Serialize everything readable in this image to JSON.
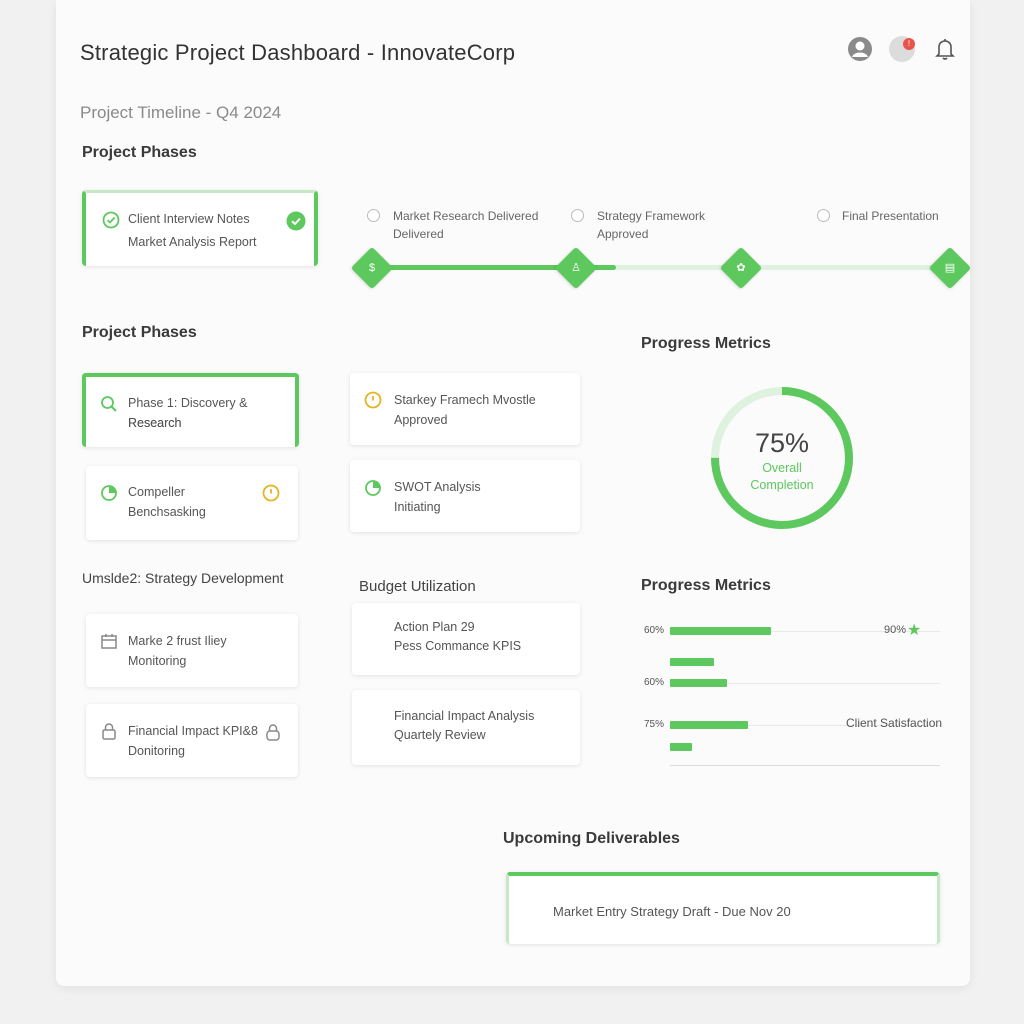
{
  "header": {
    "title": "Strategic Project Dashboard - InnovateCorp",
    "subtitle": "Project Timeline - Q4 2024",
    "icons": [
      "user-avatar-icon",
      "notification-badge-icon",
      "bell-icon"
    ],
    "badge_count": "!"
  },
  "sections": {
    "phases_top": "Project Phases",
    "phases_mid": "Project Phases",
    "progress_metrics_top": "Progress Metrics",
    "phase2_heading": "Umslde2: Strategy Development",
    "budget": "Budget Utilization",
    "progress_metrics_bottom": "Progress Metrics",
    "upcoming": "Upcoming Deliverables"
  },
  "top_card": {
    "line1": "Client Interview Notes",
    "line2": "Market Analysis Report"
  },
  "timeline": {
    "milestones": [
      {
        "line1": "Market Research Delivered",
        "line2": "Delivered"
      },
      {
        "line1": "Strategy Framework",
        "line2": "Approved"
      },
      {
        "line1": "Final Presentation",
        "line2": ""
      }
    ]
  },
  "phase_cards": {
    "discovery": {
      "line1": "Phase 1: Discovery & Research",
      "line2": "Research"
    },
    "competitor": {
      "line1": "Compeller",
      "line2": "Benchsasking"
    },
    "starkey": {
      "line1": "Starkey Framech Mvostle",
      "line2": "Approved"
    },
    "swot": {
      "line1": "SWOT Analysis",
      "line2": "Initiating"
    },
    "market": {
      "line1": "Marke 2 frust Iliey",
      "line2": "Monitoring"
    },
    "financial_kpi": {
      "line1": "Financial Impact KPI&8",
      "line2": "Donitoring"
    },
    "action_plan": {
      "line1": "Action Plan 29",
      "line2": "Pess Commance KPIS"
    },
    "financial_analysis": {
      "line1": "Financial Impact Analysis",
      "line2": "Quartely Review"
    }
  },
  "donut": {
    "value": "75%",
    "label_line1": "Overall",
    "label_line2": "Completion",
    "fraction": 0.75
  },
  "chart_data": {
    "type": "bar",
    "orientation": "horizontal",
    "bars": [
      {
        "label": "60%",
        "value": 60
      },
      {
        "label": "",
        "value": 26
      },
      {
        "label": "60%",
        "value": 34
      },
      {
        "label": "75%",
        "value": 46
      },
      {
        "label": "",
        "value": 13
      }
    ],
    "annotations": [
      "90%",
      "Client Satisfaction"
    ],
    "xlim": [
      0,
      160
    ],
    "grid": true
  },
  "deliverable": {
    "text": "Market Entry Strategy Draft - Due Nov 20"
  },
  "colors": {
    "accent": "#5cc85e",
    "accent_light": "#dff2df",
    "warning": "#e6b422",
    "badge": "#e8534a"
  }
}
